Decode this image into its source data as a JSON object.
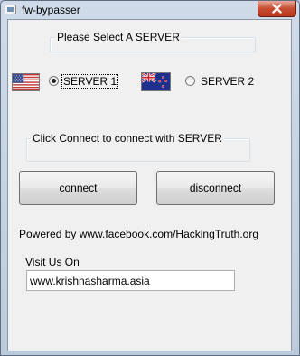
{
  "window": {
    "title": "fw-bypasser"
  },
  "server_group": {
    "label": "Please Select A SERVER"
  },
  "servers": [
    {
      "label": "SERVER 1",
      "flag": "flag-usa",
      "selected": true
    },
    {
      "label": "SERVER 2",
      "flag": "flag-new-zealand",
      "selected": false
    }
  ],
  "status_group": {
    "label": "Click Connect to connect with SERVER"
  },
  "buttons": {
    "connect": "connect",
    "disconnect": "disconnect"
  },
  "powered_by": "Powered by www.facebook.com/HackingTruth.org",
  "visit": {
    "label": "Visit Us On",
    "value": "www.krishnasharma.asia"
  },
  "colors": {
    "close_button": "#c74b30",
    "client_bg": "#f0f0f0",
    "frame": "#bccbdb"
  }
}
